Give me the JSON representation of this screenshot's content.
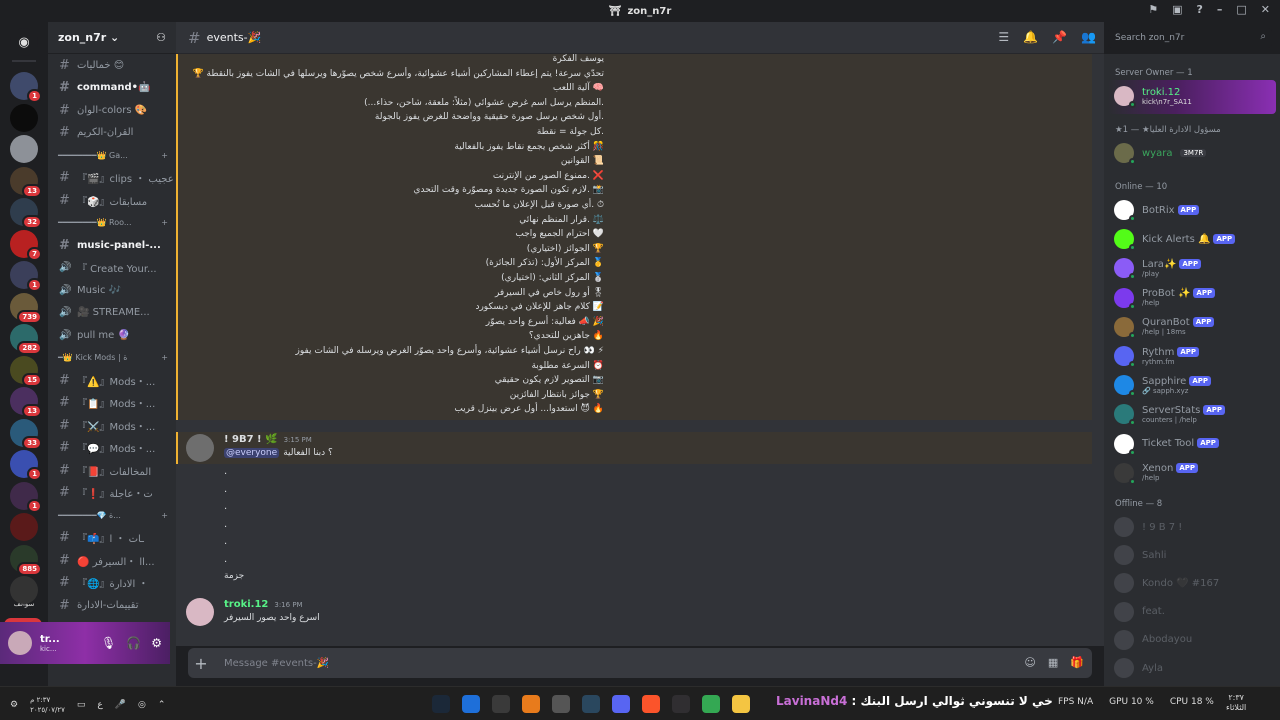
{
  "window": {
    "title": "zon_n7r"
  },
  "servers": [
    {
      "badge": "1",
      "color": "#3f4a6b"
    },
    {
      "badge": "",
      "color": "#0c0c0c"
    },
    {
      "badge": "",
      "color": "#8d9198"
    },
    {
      "badge": "13",
      "color": "#4a3b2b"
    },
    {
      "badge": "32",
      "color": "#2f3d4d"
    },
    {
      "badge": "7",
      "color": "#b82121"
    },
    {
      "badge": "1",
      "color": "#3b3f5a"
    },
    {
      "badge": "739",
      "color": "#6a5a3a"
    },
    {
      "badge": "282",
      "color": "#2c6a6a"
    },
    {
      "badge": "15",
      "color": "#4a4a20"
    },
    {
      "badge": "13",
      "color": "#4b2f5f"
    },
    {
      "badge": "33",
      "color": "#2a5a7a"
    },
    {
      "badge": "1",
      "color": "#3a4fb0"
    },
    {
      "badge": "1",
      "color": "#402a4a"
    },
    {
      "badge": "",
      "color": "#5a1a1a"
    },
    {
      "badge": "885",
      "color": "#2a3a2a"
    },
    {
      "badge": "",
      "color": "#333"
    }
  ],
  "server_extra": {
    "label_new": "NEW",
    "label_text": "سوالف"
  },
  "guild": {
    "name": "zon_n7r"
  },
  "channels": [
    {
      "kind": "ch",
      "label": "خماليات 😊",
      "bold": false
    },
    {
      "kind": "ch",
      "label": "command•🤖",
      "bold": true
    },
    {
      "kind": "ch",
      "label": "الوان-colors 🎨",
      "bold": false
    },
    {
      "kind": "ch",
      "label": "القران-الكريم",
      "bold": false
    },
    {
      "kind": "cat",
      "label": "━━━━━━━━👑 Ga..."
    },
    {
      "kind": "ch",
      "label": "『🎬』clips ・ عجيب",
      "bold": false
    },
    {
      "kind": "ch",
      "label": "『🎲』مسابقات",
      "bold": false
    },
    {
      "kind": "cat",
      "label": "━━━━━━━━👑 Roo..."
    },
    {
      "kind": "ch",
      "label": "music-panel-...",
      "bold": true
    },
    {
      "kind": "voice",
      "label": "『 Create Your...",
      "bold": false
    },
    {
      "kind": "voice",
      "label": "Music 🎶",
      "bold": false
    },
    {
      "kind": "voice",
      "label": "🎥 STREAME...",
      "bold": false
    },
    {
      "kind": "voice",
      "label": "pull me 🔮",
      "bold": false
    },
    {
      "kind": "cat",
      "label": "━👑 Kick Mods | ة"
    },
    {
      "kind": "ch",
      "label": "『⚠️』Mods・...",
      "bold": false
    },
    {
      "kind": "ch",
      "label": "『📋』Mods・...",
      "bold": false
    },
    {
      "kind": "ch",
      "label": "『⚔️』Mods・...",
      "bold": false
    },
    {
      "kind": "ch",
      "label": "『💬』Mods・...",
      "bold": false
    },
    {
      "kind": "ch",
      "label": "『📕』المخالفات",
      "bold": false
    },
    {
      "kind": "ch",
      "label": "『❗』ت・عاجلة",
      "bold": false
    },
    {
      "kind": "cat",
      "label": "━━━━━━━━💎 ة..."
    },
    {
      "kind": "ch",
      "label": "『📫』ـات ・ ا",
      "bold": false
    },
    {
      "kind": "ch",
      "label": "🔴 اا ・السيرفر...",
      "bold": false
    },
    {
      "kind": "ch",
      "label": "『🌐』الادارة ・",
      "bold": false
    },
    {
      "kind": "ch",
      "label": "تقييمات-الادارة",
      "bold": false
    }
  ],
  "user": {
    "name": "tr...",
    "sub": "kic..."
  },
  "channel": {
    "name": "events-🎉"
  },
  "search": {
    "placeholder": "Search zon_n7r"
  },
  "event_lines": [
    "يوسف الفكرة",
    "تحدّي سرعة! يتم إعطاء المشاركين أشياء عشوائية، وأسرع شخص يصوّرها ويرسلها في الشات يفوز بالنقطة 🏆",
    "🧠 آلية اللعب",
    ".المنظم يرسل اسم غرض عشوائي (مثلاً: ملعقة، شاحن، حذاء...)",
    ".أول شخص يرسل صورة حقيقية وواضحة للغرض يفوز بالجولة",
    ".كل جولة = نقطة",
    "🎊 أكثر شخص يجمع نقاط يفوز بالفعالية",
    "📜 القوانين",
    "❌ .ممنوع الصور من الإنترنت",
    "📸 .لازم تكون الصورة جديدة ومصوّرة وقت التحدي",
    "⏱ .أي صورة قبل الإعلان ما تُحسب",
    "⚖️ .قرار المنظم نهائي",
    "🤍 احترام الجميع واجب",
    "🏆 الجوائز (اختياري)",
    "🥇 المركز الأول: (تذكر الجائزة)",
    "🥈 المركز الثاني: (اختياري)",
    "🎖 أو رول خاص في السيرفر",
    "📝 كلام جاهز للإعلان في ديسكورد",
    "🎉 📣 فعالية: أسرع واحد يصوّر",
    "🔥 جاهزين للتحدي؟",
    "⚡ 👀 راح نرسل أشياء عشوائية، وأسرع واحد يصوّر الغرض ويرسله في الشات يفوز",
    "⏰ السرعة مطلوبة",
    "📷 التصوير لازم يكون حقيقي",
    "🏆 جوائز بانتظار الفائزين",
    "🔥 😈 استعدوا... أول عرض بينزل قريب"
  ],
  "messages": [
    {
      "author": "! 9B7 ! 🌿",
      "time": "3:15 PM",
      "text": "؟ دبنا الفعالية",
      "mention": "@everyone",
      "author_color": "#dbdee1"
    },
    {
      "author": "troki.12",
      "time": "3:16 PM",
      "text": "اسرع واحد يصور السيرفر",
      "author_color": "#57f287"
    }
  ],
  "dots": [
    ".",
    ".",
    ".",
    ".",
    ".",
    ".",
    "جزمة"
  ],
  "composer": {
    "placeholder": "Message #events-🎉"
  },
  "member_groups": {
    "owner_header": "Server Owner — 1",
    "admin_header": "★مسؤول الادارة العليا★ — 1",
    "online_header": "Online — 10",
    "offline_header": "Offline — 8"
  },
  "owner": {
    "name": "troki.12",
    "sub": "kick\\n7r_SA11",
    "color": "#57f287"
  },
  "admin": {
    "name": "wyara",
    "tag": "3M7R",
    "color": "#3ba55d"
  },
  "online_members": [
    {
      "name": "BotRix",
      "sub": "",
      "app": "APP",
      "color": "#ffffff"
    },
    {
      "name": "Kick Alerts 🔔",
      "sub": "",
      "app": "APP",
      "color": "#53fc18"
    },
    {
      "name": "Lara✨",
      "sub": "/play",
      "app": "APP",
      "color": "#8b5cf6"
    },
    {
      "name": "ProBot ✨",
      "sub": "/help",
      "app": "APP",
      "color": "#7c3aed"
    },
    {
      "name": "QuranBot",
      "sub": "/help | 18ms",
      "app": "APP",
      "color": "#8a6a3a"
    },
    {
      "name": "Rythm",
      "sub": "rythm.fm",
      "app": "APP",
      "color": "#5865f2"
    },
    {
      "name": "Sapphire",
      "sub": "🔗 sapph.xyz",
      "app": "APP",
      "color": "#1e88e5"
    },
    {
      "name": "ServerStats",
      "sub": "counters | /help",
      "app": "APP",
      "color": "#2a7a7a"
    },
    {
      "name": "Ticket Tool",
      "sub": "",
      "app": "APP",
      "color": "#ffffff"
    },
    {
      "name": "Xenon",
      "sub": "/help",
      "app": "APP",
      "color": "#3a3a3a"
    }
  ],
  "offline_members": [
    {
      "name": "! 9 B 7 !",
      "sub": ""
    },
    {
      "name": "Sahli",
      "sub": ""
    },
    {
      "name": "Kondo 🖤 #167",
      "sub": ""
    },
    {
      "name": "feat.",
      "sub": ""
    },
    {
      "name": "Abodayou",
      "sub": ""
    },
    {
      "name": "Ayla",
      "sub": ""
    }
  ],
  "taskbar": {
    "left_time": "٢:٣٧ م",
    "left_date": "٢٠٢٥/٠٧/٢٧",
    "lang": "ع",
    "marquee_text": "خي لا تنسوني ثوالي ارسل البنك :",
    "marquee_name": "LavinaNd4",
    "fps": "FPS N/A",
    "gpu": "GPU 10 %",
    "cpu": "CPU 18 %",
    "clock_top": "٢:٣٧",
    "clock_bottom": "الثلاثاء"
  },
  "apps": [
    {
      "name": "steam",
      "color": "#1b2838"
    },
    {
      "name": "app-blue",
      "color": "#1e6fd9"
    },
    {
      "name": "app-chat",
      "color": "#3a3a3a"
    },
    {
      "name": "app-orange",
      "color": "#e87b1c"
    },
    {
      "name": "app-gray",
      "color": "#555"
    },
    {
      "name": "steam2",
      "color": "#2a475e"
    },
    {
      "name": "discord",
      "color": "#5865f2"
    },
    {
      "name": "brave",
      "color": "#fb542b"
    },
    {
      "name": "obs",
      "color": "#302e31"
    },
    {
      "name": "chrome",
      "color": "#34a853"
    },
    {
      "name": "explorer",
      "color": "#f4c542"
    }
  ]
}
